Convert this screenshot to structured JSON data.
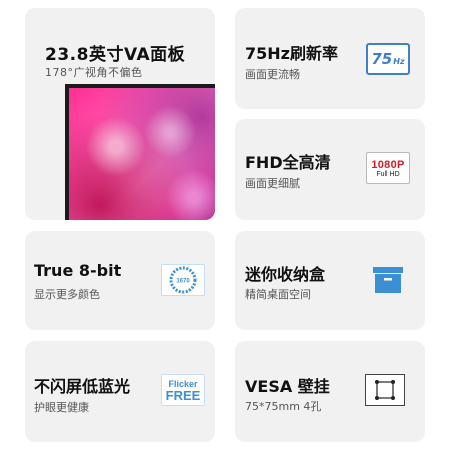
{
  "cards": {
    "size": {
      "title": "23.8英寸VA面板",
      "sub": "178°广视角不偏色"
    },
    "refresh": {
      "title": "75Hz刷新率",
      "sub": "画面更流畅",
      "icon": "75hz-icon",
      "icon_big": "75",
      "icon_small": "Hz"
    },
    "fhd": {
      "title": "FHD全高清",
      "sub": "画面更细腻",
      "icon": "1080p-full-hd-icon",
      "icon_top": "1080P",
      "icon_bottom": "Full HD"
    },
    "color": {
      "title": "True 8-bit",
      "sub": "显示更多颜色",
      "icon": "color-wheel-icon",
      "icon_text": "1670"
    },
    "storage": {
      "title": "迷你收纳盒",
      "sub": "精简桌面空间",
      "icon": "storage-box-icon"
    },
    "flicker": {
      "title": "不闪屏低蓝光",
      "sub": "护眼更健康",
      "icon": "flicker-free-icon",
      "icon_top": "Flicker",
      "icon_bottom": "FREE"
    },
    "vesa": {
      "title": "VESA 壁挂",
      "sub": "75*75mm 4孔",
      "icon": "vesa-mount-icon"
    }
  },
  "colors": {
    "card_bg": "#f1f1f1",
    "accent_blue": "#3f7fc9",
    "hd_red": "#d21d2b"
  }
}
